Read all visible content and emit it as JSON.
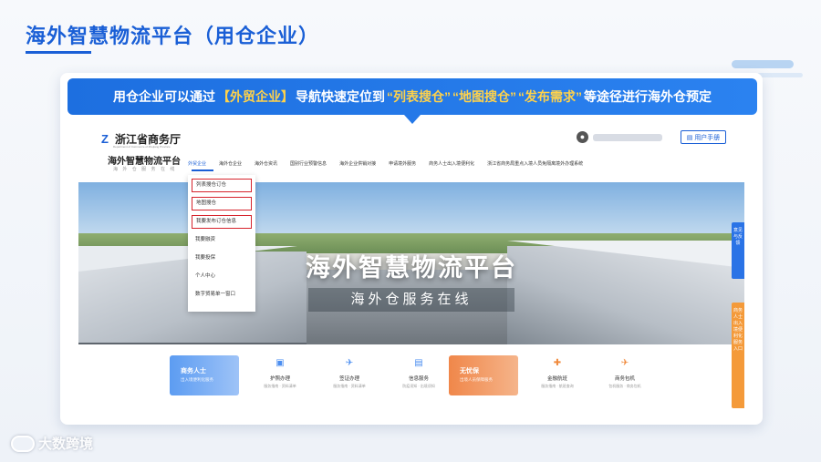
{
  "slide": {
    "title": "海外智慧物流平台（用仓企业）"
  },
  "callout": {
    "part1": "用仓企业可以通过",
    "hl1": "【外贸企业】",
    "part2": "导航快速定位到",
    "hl2": "“列表搜仓”",
    "hl3": "“地图搜仓”",
    "hl4": "“发布需求”",
    "part3": "等途径进行海外仓预定"
  },
  "site": {
    "gov_name": "浙江省商务厅",
    "gov_sub": "Department of Commerce of Zhejiang Province",
    "platform_name": "海外智慧物流平台",
    "platform_sub": "海 外 仓 服 务 在 线",
    "user_name": "",
    "manual_label": "用户手册",
    "nav": [
      "外贸企业",
      "海外仓企业",
      "海外仓资讯",
      "国别行业预警信息",
      "海外企业供销对接",
      "申请境外服务",
      "商务人士出入境便利化",
      "浙江省商务局重点入境人员免隔离境外办理系统"
    ],
    "dropdown": [
      "列表搜仓订仓",
      "地图搜仓",
      "我要发布订仓信息",
      "我要融资",
      "我要投保",
      "个人中心",
      "数字贸易单一窗口"
    ],
    "banner_title": "海外智慧物流平台",
    "banner_subtitle": "海外仓服务在线",
    "side_tab_blue": "意见与反馈",
    "side_tab_orange": "商务人士出入境便利化服务入口",
    "services": {
      "card1_title": "商务人士",
      "card1_desc": "出入境便利化服务",
      "item1_name": "护照办理",
      "item1_note": "服务指南 · 资料清单",
      "item2_name": "签证办理",
      "item2_note": "服务指南 · 资料清单",
      "item3_name": "信息服务",
      "item3_note": "防疫须知 · 出境须知",
      "card2_title": "无忧保",
      "card2_desc": "出境人员保障服务",
      "item4_name": "金融航班",
      "item4_note": "服务指南 · 航班查询",
      "item5_name": "商务包机",
      "item5_note": "包机服务 · 商务包机"
    }
  },
  "watermark": {
    "text": "大数跨境"
  },
  "icons": {
    "gov_logo": "zhejiang-logo-icon",
    "user": "user-avatar-icon",
    "manual": "book-icon",
    "watermark": "brand-logo-icon"
  },
  "colors": {
    "primary": "#1a5fd6",
    "highlight": "#ffd24a",
    "box_red": "#d6232c",
    "orange": "#f49a3a"
  }
}
